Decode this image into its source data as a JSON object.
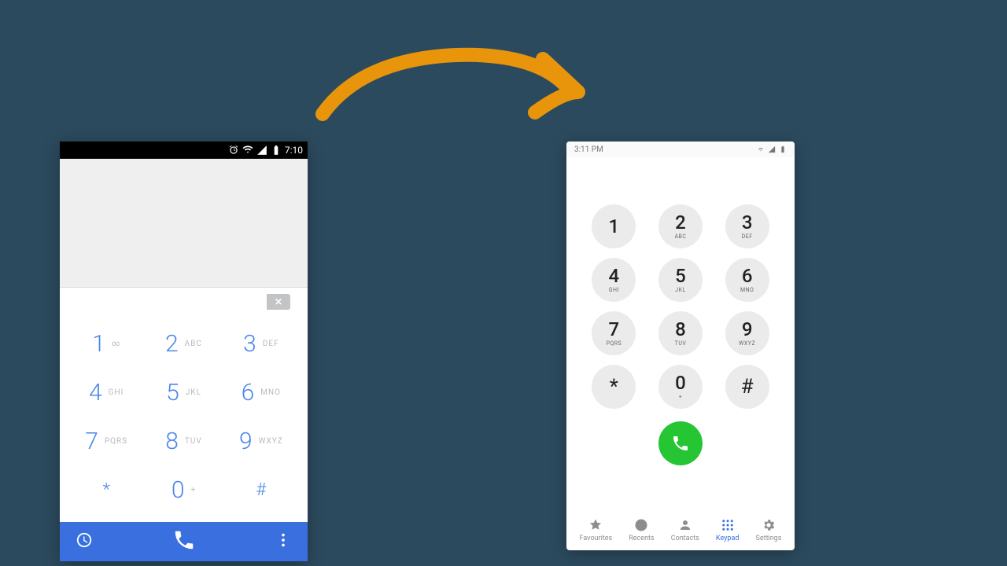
{
  "arrow_color": "#e8950b",
  "phoneA": {
    "status_time": "7:10",
    "keys": [
      {
        "n": "1",
        "l": "∞"
      },
      {
        "n": "2",
        "l": "ABC"
      },
      {
        "n": "3",
        "l": "DEF"
      },
      {
        "n": "4",
        "l": "GHI"
      },
      {
        "n": "5",
        "l": "JKL"
      },
      {
        "n": "6",
        "l": "MNO"
      },
      {
        "n": "7",
        "l": "PQRS"
      },
      {
        "n": "8",
        "l": "TUV"
      },
      {
        "n": "9",
        "l": "WXYZ"
      },
      {
        "n": "*",
        "l": ""
      },
      {
        "n": "0",
        "l": "+"
      },
      {
        "n": "#",
        "l": ""
      }
    ]
  },
  "phoneB": {
    "status_time": "3:11 PM",
    "keys": [
      {
        "n": "1",
        "l": ""
      },
      {
        "n": "2",
        "l": "ABC"
      },
      {
        "n": "3",
        "l": "DEF"
      },
      {
        "n": "4",
        "l": "GHI"
      },
      {
        "n": "5",
        "l": "JKL"
      },
      {
        "n": "6",
        "l": "MNO"
      },
      {
        "n": "7",
        "l": "PQRS"
      },
      {
        "n": "8",
        "l": "TUV"
      },
      {
        "n": "9",
        "l": "WXYZ"
      },
      {
        "n": "*",
        "l": ""
      },
      {
        "n": "0",
        "l": "+"
      },
      {
        "n": "#",
        "l": ""
      }
    ],
    "nav": [
      {
        "label": "Favourites",
        "icon": "star"
      },
      {
        "label": "Recents",
        "icon": "clock"
      },
      {
        "label": "Contacts",
        "icon": "person"
      },
      {
        "label": "Keypad",
        "icon": "grid",
        "active": true
      },
      {
        "label": "Settings",
        "icon": "gear"
      }
    ]
  }
}
